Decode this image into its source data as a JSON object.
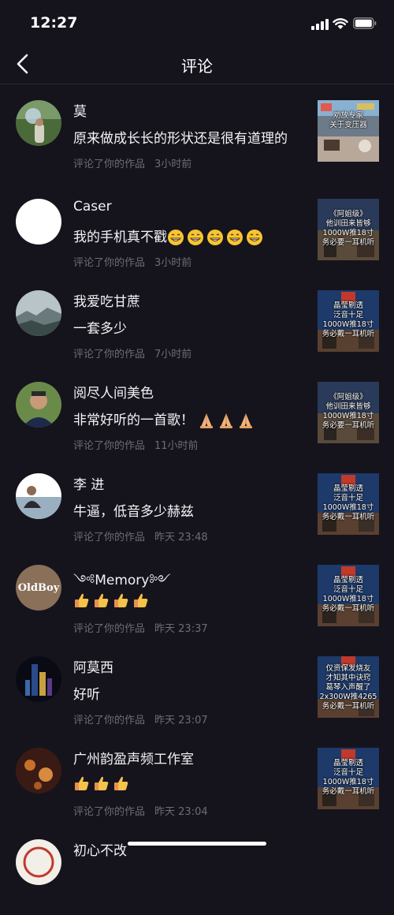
{
  "status": {
    "time": "12:27"
  },
  "nav": {
    "title": "评论"
  },
  "comments": [
    {
      "name": "莫",
      "text": "原来做成长长的形状还是很有道理的",
      "meta": "评论了你的作品",
      "time": "3小时前",
      "thumb_caption": "劝放专家\n关于变压器"
    },
    {
      "name": "Caser",
      "text": "我的手机真不戳",
      "emoji": "grin",
      "emoji_count": 5,
      "meta": "评论了你的作品",
      "time": "3小时前",
      "thumb_caption": "《阿姐级》\n他训田来皆够\n1000W推18寸\n务必要一耳机听"
    },
    {
      "name": "我爱吃甘蔗",
      "text": "一套多少",
      "meta": "评论了你的作品",
      "time": "7小时前",
      "thumb_caption": "晶莹剔透\n泛音十足\n1000W推18寸\n务必戴一耳机听"
    },
    {
      "name": "阅尽人间美色",
      "text": "非常好听的一首歌！",
      "emoji": "pray",
      "emoji_count": 3,
      "meta": "评论了你的作品",
      "time": "11小时前",
      "thumb_caption": "《阿姐级》\n他训田来皆够\n1000W推18寸\n务必要一耳机听"
    },
    {
      "name": "李 进",
      "text": "牛逼，低音多少赫兹",
      "meta": "评论了你的作品",
      "time": "昨天 23:48",
      "thumb_caption": "晶莹剔透\n泛音十足\n1000W推18寸\n务必戴一耳机听"
    },
    {
      "name": "༺Memory༻",
      "text": "",
      "emoji": "thumbs",
      "emoji_count": 4,
      "meta": "评论了你的作品",
      "time": "昨天 23:37",
      "thumb_caption": "晶莹剔透\n泛音十足\n1000W推18寸\n务必戴一耳机听"
    },
    {
      "name": "阿莫西",
      "text": "好听",
      "meta": "评论了你的作品",
      "time": "昨天 23:07",
      "thumb_caption": "仅资保发烧友\n才知其中诀窍\n葛琴入声醒了\n2x300W推4265\n务必戴一耳机听"
    },
    {
      "name": "广州韵盈声频工作室",
      "text": "",
      "emoji": "thumbs",
      "emoji_count": 3,
      "meta": "评论了你的作品",
      "time": "昨天 23:04",
      "thumb_caption": "晶莹剔透\n泛音十足\n1000W推18寸\n务必戴一耳机听"
    },
    {
      "name": "初心不改",
      "text": "",
      "meta": "",
      "time": "",
      "thumb_caption": ""
    }
  ],
  "avatar_text": {
    "memory": "OldBoy"
  },
  "colors": {
    "background": "#15141d",
    "meta": "#6d6c77",
    "divider": "#2b2a35"
  }
}
